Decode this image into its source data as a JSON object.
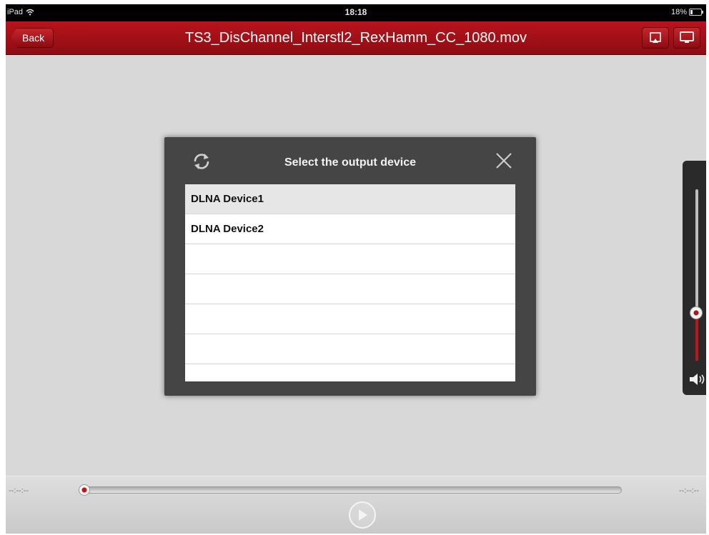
{
  "status_bar": {
    "device": "iPad",
    "time": "18:18",
    "battery": "18%",
    "battery_level": 0.18
  },
  "nav": {
    "back_label": "Back",
    "title": "TS3_DisChannel_Interstl2_RexHamm_CC_1080.mov",
    "icons": [
      "airplay-icon",
      "tv-screen-icon"
    ]
  },
  "dialog": {
    "title": "Select the output device",
    "icons": [
      "refresh-icon",
      "close-icon"
    ],
    "devices": [
      "DLNA Device1",
      "DLNA Device2",
      "",
      "",
      "",
      ""
    ],
    "selected_index": 0
  },
  "volume": {
    "level": 0.28,
    "icon": "speaker-icon"
  },
  "player": {
    "elapsed": "--:--:--",
    "remaining": "--:--:--",
    "progress": 0.0,
    "play_icon": "play-icon"
  },
  "colors": {
    "accent": "#a8101a",
    "dialog_bg": "#454545",
    "screen_bg": "#d8d8d8"
  }
}
